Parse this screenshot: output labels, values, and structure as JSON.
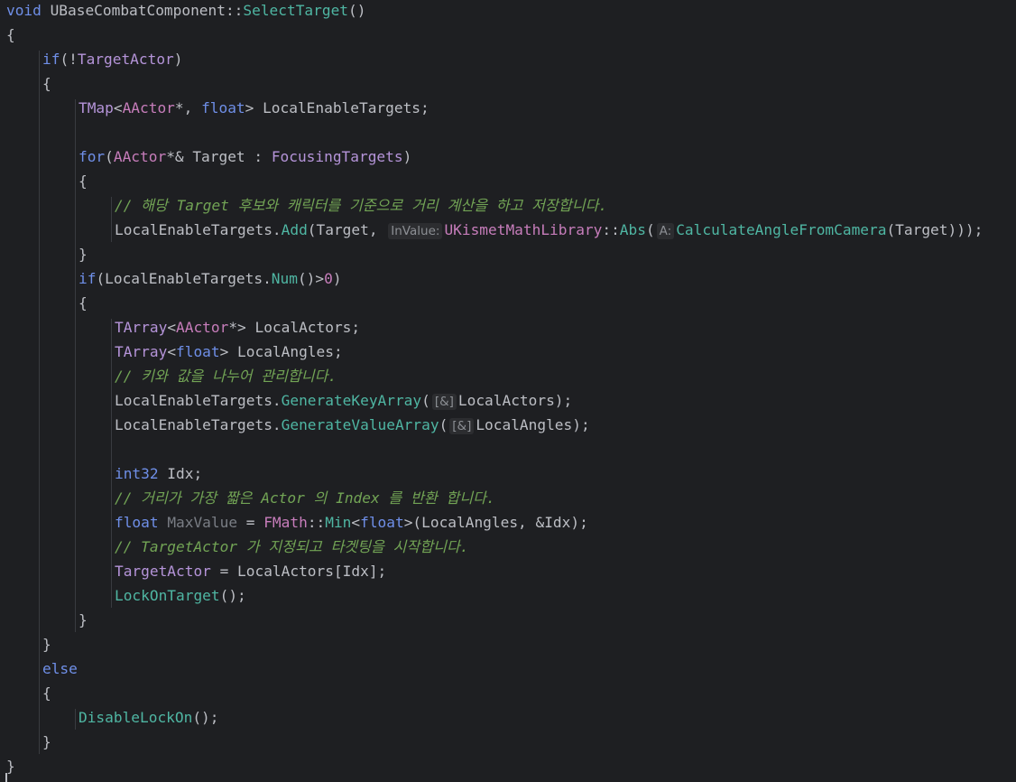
{
  "editor": {
    "background": "#1e1f22",
    "guide_color": "#393b40",
    "colors": {
      "plain": "#bcbec4",
      "keyword": "#6f8fe8",
      "type": "#b594d9",
      "function": "#4fb6a3",
      "class": "#c77dbb",
      "number": "#c77dbb",
      "comment": "#72a455",
      "unused": "#7a7e85",
      "hint_text": "#8c8f94",
      "hint_background": "#2c2d30"
    },
    "lines": [
      {
        "indent": 0,
        "tokens": [
          {
            "t": "void",
            "k": "keyword"
          },
          {
            "t": " UBaseCombatComponent",
            "k": "plain"
          },
          {
            "t": "::",
            "k": "plain"
          },
          {
            "t": "SelectTarget",
            "k": "func"
          },
          {
            "t": "()",
            "k": "plain"
          }
        ]
      },
      {
        "indent": 0,
        "tokens": [
          {
            "t": "{",
            "k": "plain"
          }
        ]
      },
      {
        "indent": 1,
        "tokens": [
          {
            "t": "if",
            "k": "keyword"
          },
          {
            "t": "(!",
            "k": "plain"
          },
          {
            "t": "TargetActor",
            "k": "type"
          },
          {
            "t": ")",
            "k": "plain"
          }
        ]
      },
      {
        "indent": 1,
        "tokens": [
          {
            "t": "{",
            "k": "plain"
          }
        ]
      },
      {
        "indent": 2,
        "tokens": [
          {
            "t": "TMap",
            "k": "type"
          },
          {
            "t": "<",
            "k": "plain"
          },
          {
            "t": "AActor",
            "k": "class"
          },
          {
            "t": "*, ",
            "k": "plain"
          },
          {
            "t": "float",
            "k": "keyword"
          },
          {
            "t": "> LocalEnableTargets;",
            "k": "plain"
          }
        ]
      },
      {
        "indent": 2,
        "tokens": []
      },
      {
        "indent": 2,
        "tokens": [
          {
            "t": "for",
            "k": "keyword"
          },
          {
            "t": "(",
            "k": "plain"
          },
          {
            "t": "AActor",
            "k": "class"
          },
          {
            "t": "*& Target : ",
            "k": "plain"
          },
          {
            "t": "FocusingTargets",
            "k": "type"
          },
          {
            "t": ")",
            "k": "plain"
          }
        ]
      },
      {
        "indent": 2,
        "tokens": [
          {
            "t": "{",
            "k": "plain"
          }
        ]
      },
      {
        "indent": 3,
        "tokens": [
          {
            "t": "// 해당 Target 후보와 캐릭터를 기준으로 거리 계산을 하고 저장합니다.",
            "k": "comment"
          }
        ]
      },
      {
        "indent": 3,
        "tokens": [
          {
            "t": "LocalEnableTargets.",
            "k": "plain"
          },
          {
            "t": "Add",
            "k": "func"
          },
          {
            "t": "(Target, ",
            "k": "plain"
          },
          {
            "t": "InValue:",
            "k": "hint"
          },
          {
            "t": "UKismetMathLibrary",
            "k": "class"
          },
          {
            "t": "::",
            "k": "plain"
          },
          {
            "t": "Abs",
            "k": "func"
          },
          {
            "t": "(",
            "k": "plain"
          },
          {
            "t": "A:",
            "k": "hint"
          },
          {
            "t": "CalculateAngleFromCamera",
            "k": "func"
          },
          {
            "t": "(Target)));",
            "k": "plain"
          }
        ]
      },
      {
        "indent": 2,
        "tokens": [
          {
            "t": "}",
            "k": "plain"
          }
        ]
      },
      {
        "indent": 2,
        "tokens": [
          {
            "t": "if",
            "k": "keyword"
          },
          {
            "t": "(LocalEnableTargets.",
            "k": "plain"
          },
          {
            "t": "Num",
            "k": "func"
          },
          {
            "t": "()>",
            "k": "plain"
          },
          {
            "t": "0",
            "k": "number"
          },
          {
            "t": ")",
            "k": "plain"
          }
        ]
      },
      {
        "indent": 2,
        "tokens": [
          {
            "t": "{",
            "k": "plain"
          }
        ]
      },
      {
        "indent": 3,
        "tokens": [
          {
            "t": "TArray",
            "k": "type"
          },
          {
            "t": "<",
            "k": "plain"
          },
          {
            "t": "AActor",
            "k": "class"
          },
          {
            "t": "*> LocalActors;",
            "k": "plain"
          }
        ]
      },
      {
        "indent": 3,
        "tokens": [
          {
            "t": "TArray",
            "k": "type"
          },
          {
            "t": "<",
            "k": "plain"
          },
          {
            "t": "float",
            "k": "keyword"
          },
          {
            "t": "> LocalAngles;",
            "k": "plain"
          }
        ]
      },
      {
        "indent": 3,
        "tokens": [
          {
            "t": "// 키와 값을 나누어 관리합니다.",
            "k": "comment"
          }
        ]
      },
      {
        "indent": 3,
        "tokens": [
          {
            "t": "LocalEnableTargets.",
            "k": "plain"
          },
          {
            "t": "GenerateKeyArray",
            "k": "func"
          },
          {
            "t": "(",
            "k": "plain"
          },
          {
            "t": "[&]",
            "k": "hint"
          },
          {
            "t": "LocalActors);",
            "k": "plain"
          }
        ]
      },
      {
        "indent": 3,
        "tokens": [
          {
            "t": "LocalEnableTargets.",
            "k": "plain"
          },
          {
            "t": "GenerateValueArray",
            "k": "func"
          },
          {
            "t": "(",
            "k": "plain"
          },
          {
            "t": "[&]",
            "k": "hint"
          },
          {
            "t": "LocalAngles);",
            "k": "plain"
          }
        ]
      },
      {
        "indent": 3,
        "tokens": []
      },
      {
        "indent": 3,
        "tokens": [
          {
            "t": "int32",
            "k": "keyword"
          },
          {
            "t": " Idx;",
            "k": "plain"
          }
        ]
      },
      {
        "indent": 3,
        "tokens": [
          {
            "t": "// 거리가 가장 짧은 Actor 의 Index 를 반환 합니다.",
            "k": "comment"
          }
        ]
      },
      {
        "indent": 3,
        "tokens": [
          {
            "t": "float",
            "k": "keyword"
          },
          {
            "t": " ",
            "k": "plain"
          },
          {
            "t": "MaxValue",
            "k": "unused"
          },
          {
            "t": " = ",
            "k": "plain"
          },
          {
            "t": "FMath",
            "k": "class"
          },
          {
            "t": "::",
            "k": "plain"
          },
          {
            "t": "Min",
            "k": "func"
          },
          {
            "t": "<",
            "k": "plain"
          },
          {
            "t": "float",
            "k": "keyword"
          },
          {
            "t": ">(LocalAngles, &Idx);",
            "k": "plain"
          }
        ]
      },
      {
        "indent": 3,
        "tokens": [
          {
            "t": "// TargetActor 가 지정되고 타겟팅을 시작합니다.",
            "k": "comment"
          }
        ]
      },
      {
        "indent": 3,
        "tokens": [
          {
            "t": "TargetActor",
            "k": "type"
          },
          {
            "t": " = LocalActors[Idx];",
            "k": "plain"
          }
        ]
      },
      {
        "indent": 3,
        "tokens": [
          {
            "t": "LockOnTarget",
            "k": "func"
          },
          {
            "t": "();",
            "k": "plain"
          }
        ]
      },
      {
        "indent": 2,
        "tokens": [
          {
            "t": "}",
            "k": "plain"
          }
        ]
      },
      {
        "indent": 1,
        "tokens": [
          {
            "t": "}",
            "k": "plain"
          }
        ]
      },
      {
        "indent": 1,
        "tokens": [
          {
            "t": "else",
            "k": "keyword"
          }
        ]
      },
      {
        "indent": 1,
        "tokens": [
          {
            "t": "{",
            "k": "plain"
          }
        ]
      },
      {
        "indent": 2,
        "tokens": [
          {
            "t": "DisableLockOn",
            "k": "func"
          },
          {
            "t": "();",
            "k": "plain"
          }
        ]
      },
      {
        "indent": 1,
        "tokens": [
          {
            "t": "}",
            "k": "plain"
          }
        ]
      },
      {
        "indent": 0,
        "tokens": [
          {
            "t": "}",
            "k": "plain"
          }
        ]
      }
    ]
  }
}
